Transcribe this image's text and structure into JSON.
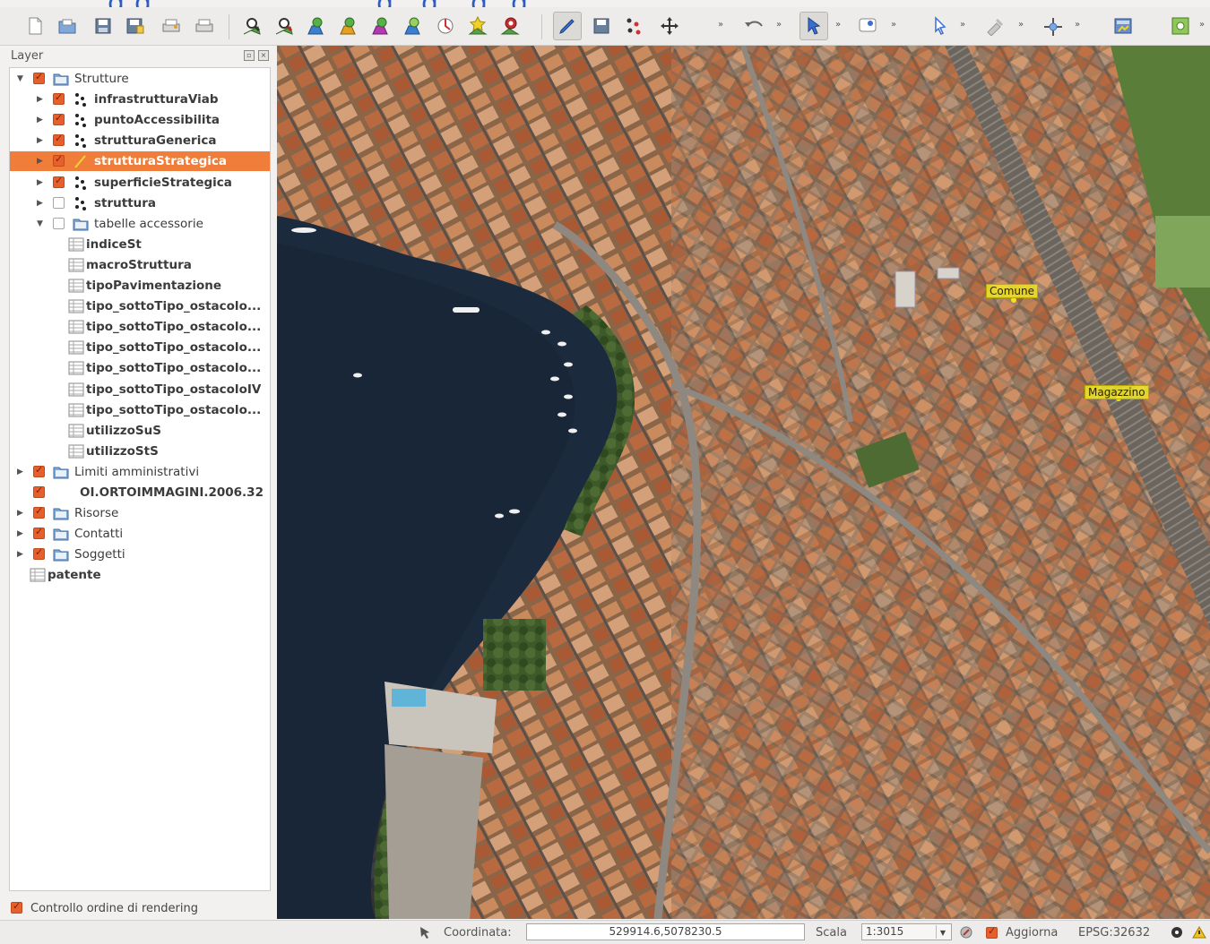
{
  "colors": {
    "selection": "#f07d3a",
    "checkbox_on": "#e6602d",
    "map_label_bg": "#f0e628"
  },
  "toolbar": {
    "buttons": [
      {
        "name": "new-project-icon"
      },
      {
        "name": "open-project-icon"
      },
      {
        "name": "save-project-icon"
      },
      {
        "name": "save-as-icon"
      },
      {
        "name": "print-composer-icon"
      },
      {
        "name": "print-icon"
      },
      {
        "name": "pan-map-icon"
      },
      {
        "name": "pan-to-selection-icon"
      },
      {
        "name": "zoom-in-icon"
      },
      {
        "name": "zoom-out-icon"
      },
      {
        "name": "zoom-full-icon"
      },
      {
        "name": "zoom-layer-icon"
      },
      {
        "name": "zoom-selection-icon"
      },
      {
        "name": "zoom-last-icon"
      },
      {
        "name": "refresh-icon"
      },
      {
        "name": "toggle-editing-icon"
      },
      {
        "name": "save-edits-icon"
      },
      {
        "name": "add-feature-icon"
      },
      {
        "name": "move-feature-icon"
      },
      {
        "name": "undo-icon"
      },
      {
        "name": "identify-icon"
      },
      {
        "name": "map-tips-icon"
      },
      {
        "name": "select-icon"
      },
      {
        "name": "measure-icon"
      },
      {
        "name": "digitize-icon"
      },
      {
        "name": "database-icon"
      },
      {
        "name": "plugin-icon"
      }
    ],
    "more_symbol": "»"
  },
  "layer_panel": {
    "title": "Layer",
    "tree": [
      {
        "label": "Strutture",
        "kind": "group",
        "checked": true,
        "expanded": true,
        "level": 0,
        "bold": false
      },
      {
        "label": "infrastrutturaViab",
        "kind": "point",
        "checked": true,
        "expanded": false,
        "level": 1,
        "bold": true
      },
      {
        "label": "puntoAccessibilita",
        "kind": "point",
        "checked": true,
        "expanded": false,
        "level": 1,
        "bold": true
      },
      {
        "label": "strutturaGenerica",
        "kind": "point",
        "checked": true,
        "expanded": false,
        "level": 1,
        "bold": true
      },
      {
        "label": "strutturaStrategica",
        "kind": "line",
        "checked": true,
        "expanded": false,
        "level": 1,
        "bold": true,
        "selected": true
      },
      {
        "label": "superficieStrategica",
        "kind": "point",
        "checked": true,
        "expanded": false,
        "level": 1,
        "bold": true
      },
      {
        "label": "struttura",
        "kind": "point",
        "checked": false,
        "expanded": false,
        "level": 1,
        "bold": true
      },
      {
        "label": "tabelle accessorie",
        "kind": "group",
        "checked": false,
        "expanded": true,
        "level": 1,
        "bold": false
      },
      {
        "label": "indiceSt",
        "kind": "table",
        "level": 2,
        "bold": true
      },
      {
        "label": "macroStruttura",
        "kind": "table",
        "level": 2,
        "bold": true
      },
      {
        "label": "tipoPavimentazione",
        "kind": "table",
        "level": 2,
        "bold": true
      },
      {
        "label": "tipo_sottoTipo_ostacolo...",
        "kind": "table",
        "level": 2,
        "bold": true
      },
      {
        "label": "tipo_sottoTipo_ostacolo...",
        "kind": "table",
        "level": 2,
        "bold": true
      },
      {
        "label": "tipo_sottoTipo_ostacolo...",
        "kind": "table",
        "level": 2,
        "bold": true
      },
      {
        "label": "tipo_sottoTipo_ostacolo...",
        "kind": "table",
        "level": 2,
        "bold": true
      },
      {
        "label": "tipo_sottoTipo_ostacoloIV",
        "kind": "table",
        "level": 2,
        "bold": true
      },
      {
        "label": "tipo_sottoTipo_ostacolo...",
        "kind": "table",
        "level": 2,
        "bold": true
      },
      {
        "label": "utilizzoSuS",
        "kind": "table",
        "level": 2,
        "bold": true
      },
      {
        "label": "utilizzoStS",
        "kind": "table",
        "level": 2,
        "bold": true
      },
      {
        "label": "Limiti amministrativi",
        "kind": "group",
        "checked": true,
        "expanded": false,
        "level": 0,
        "bold": false
      },
      {
        "label": "OI.ORTOIMMAGINI.2006.32",
        "kind": "raster",
        "checked": true,
        "level": 0,
        "bold": true
      },
      {
        "label": "Risorse",
        "kind": "group",
        "checked": true,
        "expanded": false,
        "level": 0,
        "bold": false
      },
      {
        "label": "Contatti",
        "kind": "group",
        "checked": true,
        "expanded": false,
        "level": 0,
        "bold": false
      },
      {
        "label": "Soggetti",
        "kind": "group",
        "checked": true,
        "expanded": false,
        "level": 0,
        "bold": false
      },
      {
        "label": "patente",
        "kind": "table",
        "level": 0,
        "bold": true,
        "root_table": true
      }
    ],
    "render_order_label": "Controllo ordine di rendering",
    "render_order_checked": true
  },
  "map": {
    "labels": [
      {
        "text": "Comune"
      },
      {
        "text": "Magazzino"
      }
    ]
  },
  "statusbar": {
    "coord_label": "Coordinata:",
    "coord_value": "529914.6,5078230.5",
    "scale_label": "Scala",
    "scale_value": "1:3015",
    "render_label": "Aggiorna",
    "crs": "EPSG:32632"
  }
}
